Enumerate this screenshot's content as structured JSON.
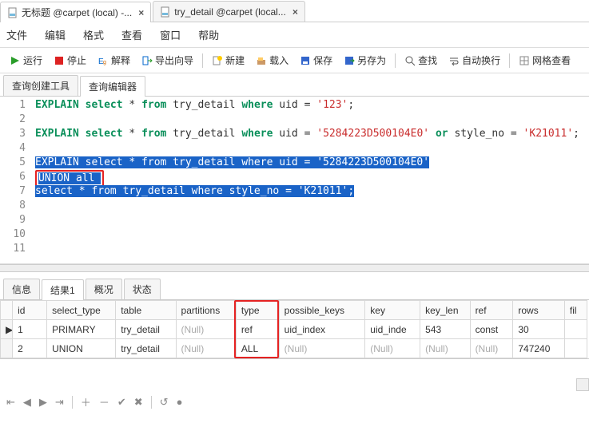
{
  "tabs_top": [
    {
      "label": "无标题 @carpet (local) -...",
      "active": true
    },
    {
      "label": "try_detail @carpet (local...",
      "active": false
    }
  ],
  "menubar": [
    "文件",
    "编辑",
    "格式",
    "查看",
    "窗口",
    "帮助"
  ],
  "toolbar": {
    "run": "运行",
    "stop": "停止",
    "explain": "解释",
    "export": "导出向导",
    "new": "新建",
    "load": "载入",
    "save": "保存",
    "saveas": "另存为",
    "find": "查找",
    "wrap": "自动换行",
    "gridview": "网格查看"
  },
  "query_tabs": [
    {
      "label": "查询创建工具",
      "active": false
    },
    {
      "label": "查询编辑器",
      "active": true
    }
  ],
  "code": {
    "line_count": 11,
    "lines": [
      {
        "n": 1,
        "t": [
          {
            "c": "kw",
            "v": "EXPLAIN"
          },
          {
            "v": " "
          },
          {
            "c": "kw",
            "v": "select"
          },
          {
            "v": " * "
          },
          {
            "c": "kw",
            "v": "from"
          },
          {
            "v": " try_detail "
          },
          {
            "c": "kw",
            "v": "where"
          },
          {
            "v": " uid = "
          },
          {
            "c": "str",
            "v": "'123'"
          },
          {
            "v": ";"
          }
        ]
      },
      {
        "n": 2,
        "t": []
      },
      {
        "n": 3,
        "t": [
          {
            "c": "kw",
            "v": "EXPLAIN"
          },
          {
            "v": " "
          },
          {
            "c": "kw",
            "v": "select"
          },
          {
            "v": " * "
          },
          {
            "c": "kw",
            "v": "from"
          },
          {
            "v": " try_detail "
          },
          {
            "c": "kw",
            "v": "where"
          },
          {
            "v": " uid = "
          },
          {
            "c": "str",
            "v": "'5284223D500104E0'"
          },
          {
            "v": " "
          },
          {
            "c": "kw",
            "v": "or"
          },
          {
            "v": " style_no = "
          },
          {
            "c": "str",
            "v": "'K21011'"
          },
          {
            "v": ";"
          }
        ]
      },
      {
        "n": 4,
        "t": []
      },
      {
        "n": 5,
        "sel": true,
        "t": [
          {
            "v": "EXPLAIN select * from try_detail where uid = '5284223D500104E0'"
          }
        ]
      },
      {
        "n": 6,
        "sel": true,
        "redbox": true,
        "t": [
          {
            "v": "UNION all "
          }
        ]
      },
      {
        "n": 7,
        "sel": true,
        "t": [
          {
            "v": "select * from try_detail where style_no = 'K21011';"
          }
        ]
      },
      {
        "n": 8,
        "t": []
      },
      {
        "n": 9,
        "t": []
      },
      {
        "n": 10,
        "t": []
      },
      {
        "n": 11,
        "t": []
      }
    ]
  },
  "result_tabs": [
    {
      "label": "信息",
      "active": false
    },
    {
      "label": "结果1",
      "active": true
    },
    {
      "label": "概况",
      "active": false
    },
    {
      "label": "状态",
      "active": false
    }
  ],
  "grid": {
    "columns": [
      "id",
      "select_type",
      "table",
      "partitions",
      "type",
      "possible_keys",
      "key",
      "key_len",
      "ref",
      "rows",
      "fil"
    ],
    "rows": [
      {
        "_marker": "▶",
        "id": "1",
        "select_type": "PRIMARY",
        "table": "try_detail",
        "partitions": null,
        "type": "ref",
        "possible_keys": "uid_index",
        "key": "uid_inde",
        "key_len": "543",
        "ref": "const",
        "rows": "30"
      },
      {
        "_marker": "",
        "id": "2",
        "select_type": "UNION",
        "table": "try_detail",
        "partitions": null,
        "type": "ALL",
        "possible_keys": null,
        "key": null,
        "key_len": null,
        "ref": null,
        "rows": "747240"
      }
    ],
    "null_text": "(Null)",
    "highlight_col": "type"
  },
  "navbar": [
    "⇤",
    "◀",
    "▶",
    "⇥",
    "＋",
    "－",
    "✔",
    "✖",
    "↺",
    "●"
  ]
}
